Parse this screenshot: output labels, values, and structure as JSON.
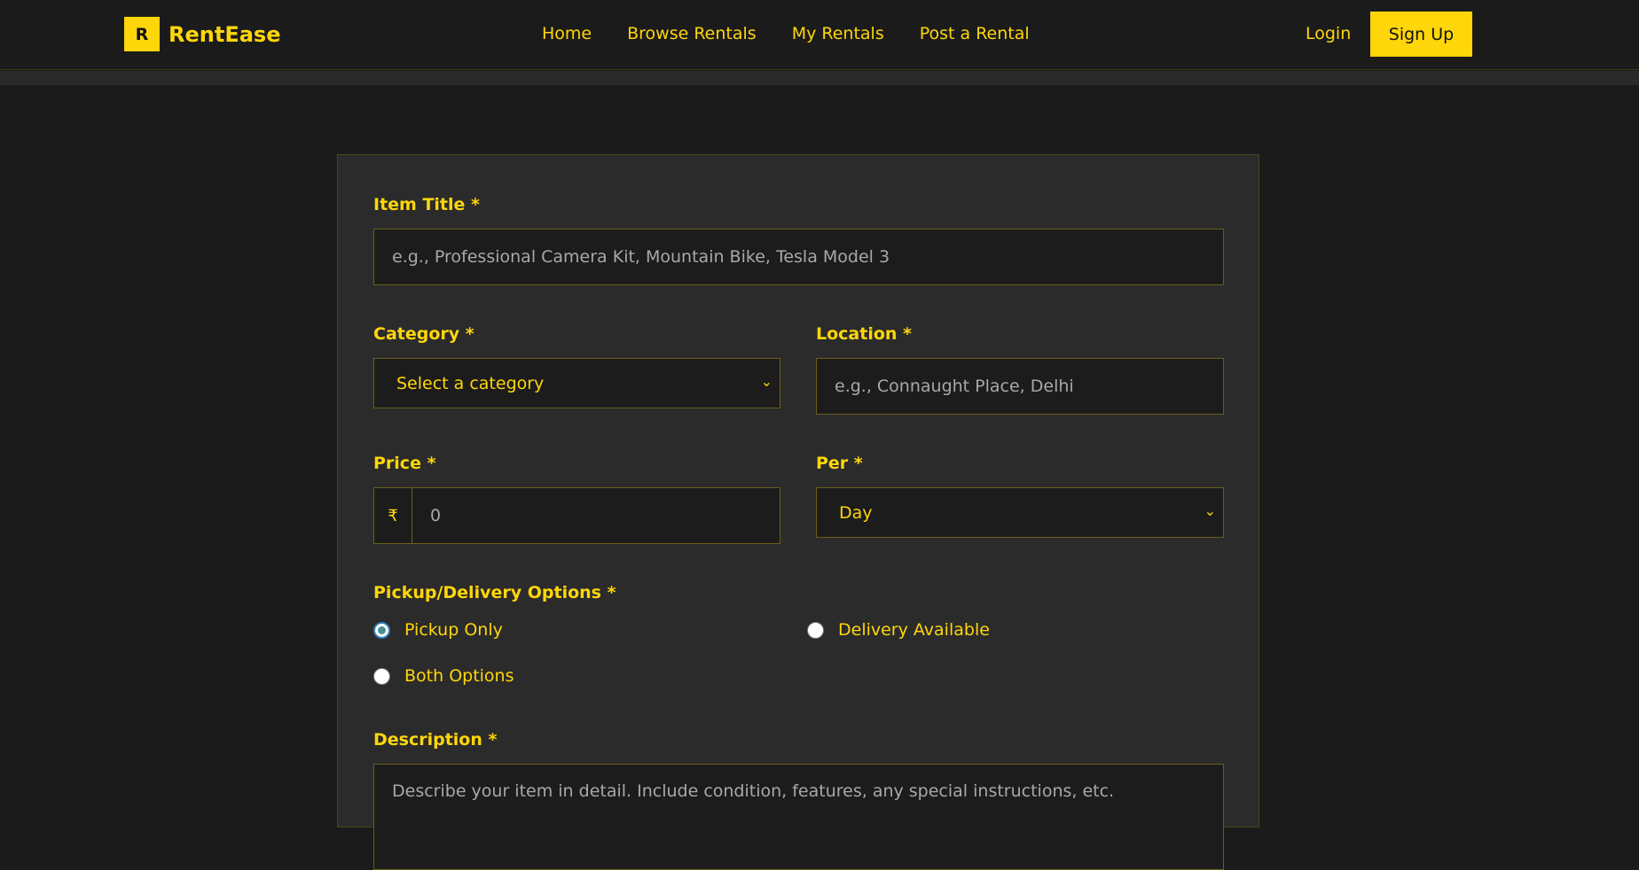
{
  "nav": {
    "logo_letter": "R",
    "brand": "RentEase",
    "links": [
      "Home",
      "Browse Rentals",
      "My Rentals",
      "Post a Rental"
    ],
    "login": "Login",
    "signup": "Sign Up"
  },
  "form": {
    "title_label": "Item Title *",
    "title_placeholder": "e.g., Professional Camera Kit, Mountain Bike, Tesla Model 3",
    "category_label": "Category *",
    "category_value": "Select a category",
    "location_label": "Location *",
    "location_placeholder": "e.g., Connaught Place, Delhi",
    "price_label": "Price *",
    "currency_symbol": "₹",
    "price_placeholder": "0",
    "per_label": "Per *",
    "per_value": "Day",
    "pickup_label": "Pickup/Delivery Options *",
    "options": [
      {
        "label": "Pickup Only",
        "checked": true
      },
      {
        "label": "Delivery Available",
        "checked": false
      },
      {
        "label": "Both Options",
        "checked": false
      }
    ],
    "description_label": "Description *",
    "description_placeholder": "Describe your item in detail. Include condition, features, any special instructions, etc."
  },
  "colors": {
    "accent": "#ffd60a",
    "background": "#1b1b1b",
    "card": "#2b2b2b"
  }
}
